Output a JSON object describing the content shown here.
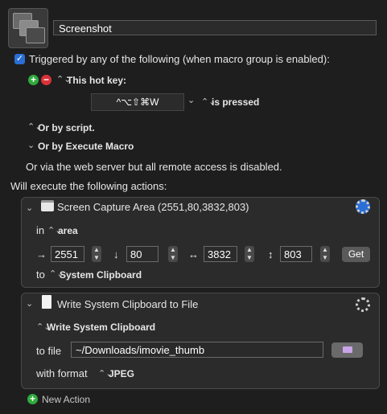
{
  "macro": {
    "name": "Screenshot"
  },
  "trigger": {
    "header": "Triggered by any of the following (when macro group is enabled):",
    "hotkey_label": "This hot key:",
    "hotkey_value": "^⌥⇧⌘W",
    "hotkey_state": "is pressed",
    "or_script": "Or by script.",
    "or_execute_macro": "Or by Execute Macro",
    "web_server_note": "Or via the web server but all remote access is disabled."
  },
  "actions_header": "Will execute the following actions:",
  "action1": {
    "title": "Screen Capture Area (2551,80,3832,803)",
    "in_label": "in",
    "in_value": "area",
    "x": "2551",
    "y": "80",
    "width": "3832",
    "height": "803",
    "get_label": "Get",
    "to_label": "to",
    "to_value": "System Clipboard",
    "arrows": {
      "right": "→",
      "down": "↓",
      "horizontal": "↔",
      "vertical": "↕"
    }
  },
  "action2": {
    "title": "Write System Clipboard to File",
    "source_value": "Write System Clipboard",
    "to_file_label": "to file",
    "to_file_value": "~/Downloads/imovie_thumb",
    "format_label": "with format",
    "format_value": "JPEG"
  },
  "new_action_label": "New Action",
  "colors": {
    "accent": "#2a6fd6",
    "green": "#2eab3c",
    "red": "#d9323a",
    "background": "#1e1e1e"
  }
}
